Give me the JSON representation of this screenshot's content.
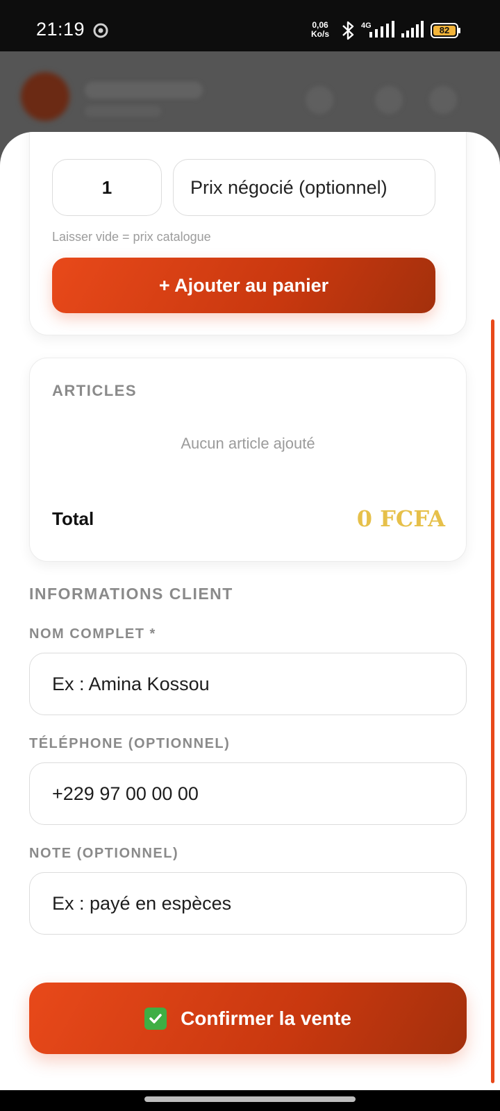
{
  "status_bar": {
    "time": "21:19",
    "speed_value": "0,06",
    "speed_unit": "Ko/s",
    "network": "4G",
    "battery": "82"
  },
  "form": {
    "quantity": "1",
    "price_placeholder": "Prix négocié (optionnel)",
    "price_hint": "Laisser vide = prix catalogue",
    "add_button": "+ Ajouter au panier"
  },
  "articles": {
    "title": "ARTICLES",
    "empty_message": "Aucun article ajouté",
    "total_label": "Total",
    "total_value": "0 FCFA"
  },
  "client": {
    "section_title": "INFORMATIONS CLIENT",
    "name_label": "NOM COMPLET *",
    "name_placeholder": "Ex : Amina Kossou",
    "phone_label": "TÉLÉPHONE (OPTIONNEL)",
    "phone_placeholder": "+229 97 00 00 00",
    "note_label": "NOTE (OPTIONNEL)",
    "note_placeholder": "Ex : payé en espèces"
  },
  "confirm_button": "Confirmer la vente",
  "colors": {
    "accent": "#e8491a",
    "accent_dark": "#a3300c",
    "total": "#e6c04a"
  }
}
